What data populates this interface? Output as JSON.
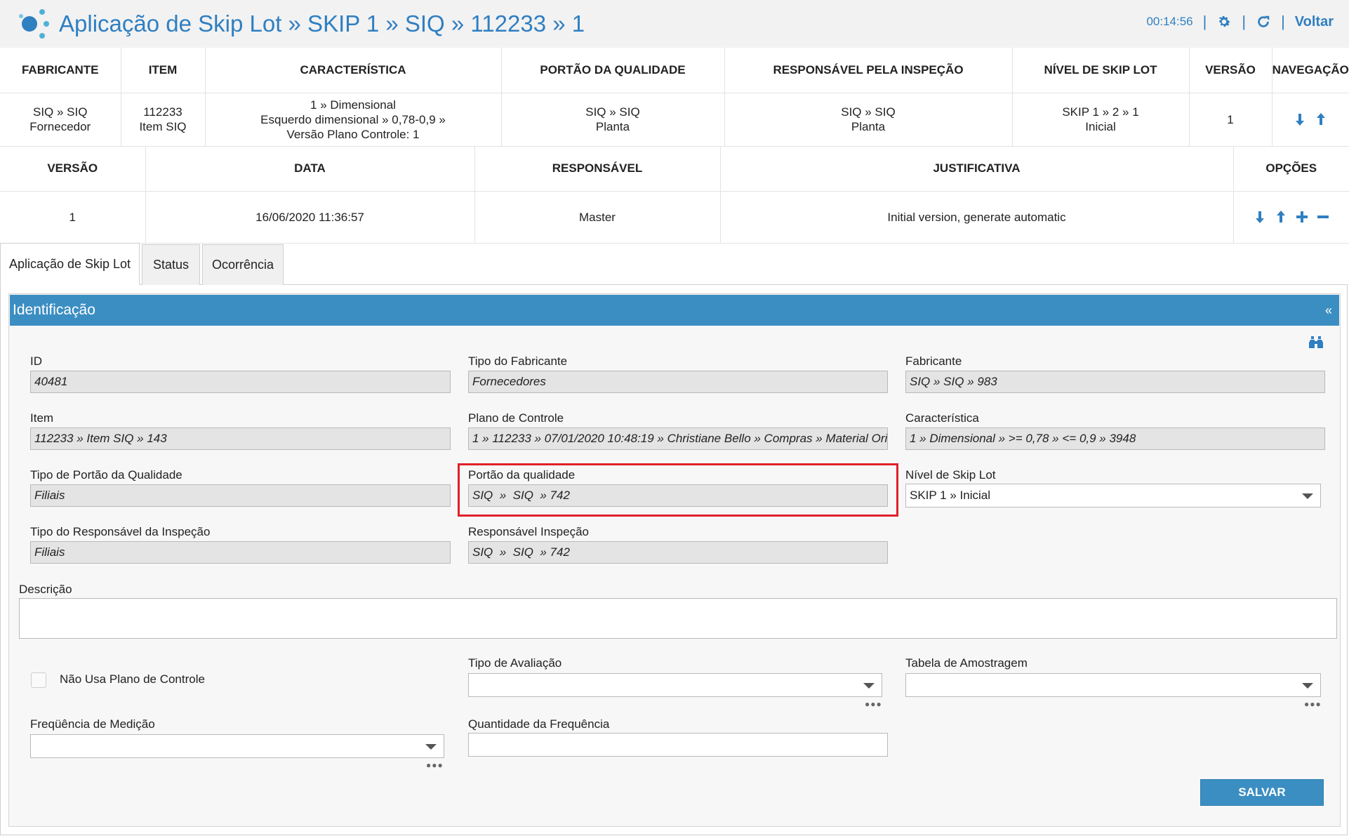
{
  "header": {
    "title": "Aplicação de Skip Lot » SKIP 1 » SIQ » 112233 » 1",
    "timer": "00:14:56",
    "back_label": "Voltar",
    "icons": [
      "gear-icon",
      "refresh-icon"
    ]
  },
  "summary_table": {
    "headers": [
      "FABRICANTE",
      "ITEM",
      "CARACTERÍSTICA",
      "PORTÃO DA QUALIDADE",
      "RESPONSÁVEL PELA INSPEÇÃO",
      "NÍVEL DE SKIP LOT",
      "VERSÃO",
      "NAVEGAÇÃO"
    ],
    "row": {
      "fabricante": [
        "SIQ » SIQ",
        "Fornecedor"
      ],
      "item": [
        "112233",
        "Item SIQ"
      ],
      "caracteristica": [
        "1 » Dimensional",
        "Esquerdo dimensional » 0,78-0,9 »",
        "Versão Plano Controle: 1"
      ],
      "portao": [
        "SIQ » SIQ",
        "Planta"
      ],
      "responsavel": [
        "SIQ » SIQ",
        "Planta"
      ],
      "nivel": [
        "SKIP 1 » 2 » 1",
        "Inicial"
      ],
      "versao": "1"
    }
  },
  "version_table": {
    "headers": [
      "VERSÃO",
      "DATA",
      "RESPONSÁVEL",
      "JUSTIFICATIVA",
      "OPÇÕES"
    ],
    "row": {
      "versao": "1",
      "data": "16/06/2020 11:36:57",
      "responsavel": "Master",
      "justificativa": "Initial version, generate automatic"
    }
  },
  "tabs": [
    {
      "label": "Aplicação de Skip Lot",
      "active": true
    },
    {
      "label": "Status",
      "active": false
    },
    {
      "label": "Ocorrência",
      "active": false
    }
  ],
  "panel": {
    "title": "Identificação",
    "collapse_glyph": "«"
  },
  "form": {
    "id": {
      "label": "ID",
      "value": "40481"
    },
    "tipo_fabricante": {
      "label": "Tipo do Fabricante",
      "value": "Fornecedores"
    },
    "fabricante": {
      "label": "Fabricante",
      "value": "SIQ » SIQ » 983"
    },
    "item": {
      "label": "Item",
      "value": "112233 » Item SIQ » 143"
    },
    "plano_controle": {
      "label": "Plano de Controle",
      "value": "1 » 112233 » 07/01/2020 10:48:19 » Christiane Bello » Compras » Material Ori"
    },
    "caracteristica": {
      "label": "Característica",
      "value": "1 » Dimensional » >= 0,78 » <= 0,9 » 3948"
    },
    "tipo_portao": {
      "label": "Tipo de Portão da Qualidade",
      "value": "Filiais"
    },
    "portao": {
      "label": "Portão da qualidade",
      "value": "SIQ  »  SIQ  » 742"
    },
    "nivel_skip": {
      "label": "Nível de Skip Lot",
      "value": "SKIP 1 » Inicial"
    },
    "tipo_responsavel": {
      "label": "Tipo do Responsável da Inspeção",
      "value": "Filiais"
    },
    "responsavel": {
      "label": "Responsável Inspeção",
      "value": "SIQ  »  SIQ  » 742"
    },
    "descricao": {
      "label": "Descrição",
      "value": ""
    },
    "nao_usa_plano": {
      "label": "Não Usa Plano de Controle",
      "checked": false
    },
    "tipo_avaliacao": {
      "label": "Tipo de Avaliação",
      "value": ""
    },
    "tabela_amostragem": {
      "label": "Tabela de Amostragem",
      "value": ""
    },
    "frequencia_medicao": {
      "label": "Freqüência de Medição",
      "value": ""
    },
    "quantidade_frequencia": {
      "label": "Quantidade da Frequência",
      "value": ""
    }
  },
  "actions": {
    "save_label": "SALVAR"
  },
  "colors": {
    "accent": "#2f7fc1",
    "panel_header": "#3b8ec2",
    "highlight": "#e0202a"
  }
}
